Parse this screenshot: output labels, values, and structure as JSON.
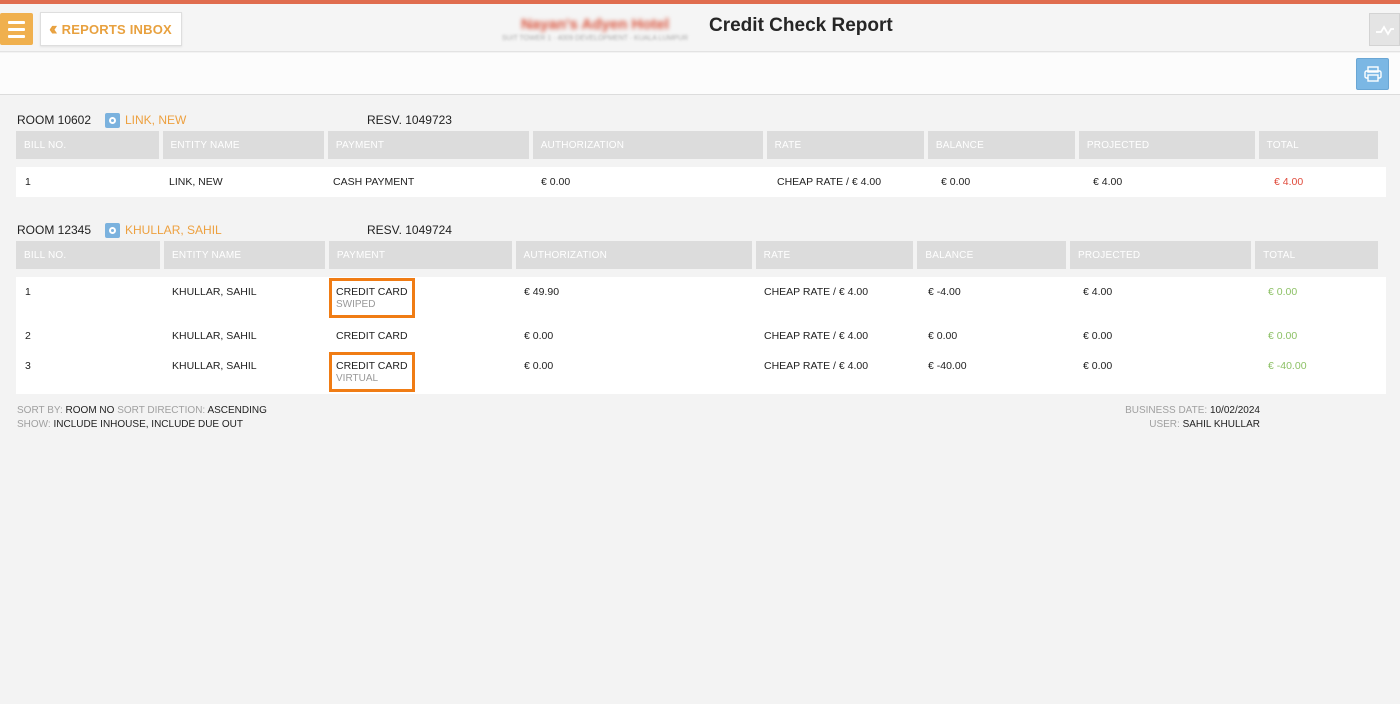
{
  "header": {
    "menu_icon": "hamburger-icon",
    "back_label": "REPORTS INBOX",
    "back_icon": "double-chevron-left-icon",
    "hotel_name": "Nayan's Adyen Hotel",
    "hotel_address": "SUIT TOWER 1 · 4009 DEVELOPMENT · KUALA LUMPUR",
    "title": "Credit Check Report",
    "graph_icon": "graph-icon"
  },
  "toolbar": {
    "print_icon": "print-icon"
  },
  "columns": [
    "BILL NO.",
    "ENTITY NAME",
    "PAYMENT",
    "AUTHORIZATION",
    "RATE",
    "BALANCE",
    "PROJECTED",
    "TOTAL"
  ],
  "rooms": [
    {
      "room": "ROOM 10602",
      "guest": "LINK, NEW",
      "resv": "RESV. 1049723",
      "rows": [
        {
          "bill": "1",
          "entity": "LINK, NEW",
          "payment": "CASH PAYMENT",
          "payment_sub": "",
          "auth": "€ 0.00",
          "rate": "CHEAP RATE / € 4.00",
          "balance": "€ 0.00",
          "projected": "€ 4.00",
          "total": "€ 4.00"
        }
      ]
    },
    {
      "room": "ROOM 12345",
      "guest": "KHULLAR, SAHIL",
      "resv": "RESV. 1049724",
      "rows": [
        {
          "bill": "1",
          "entity": "KHULLAR, SAHIL",
          "payment": "CREDIT CARD",
          "payment_sub": "SWIPED",
          "auth": "€ 49.90",
          "rate": "CHEAP RATE / € 4.00",
          "balance": "€ -4.00",
          "projected": "€ 4.00",
          "total": "€ 0.00"
        },
        {
          "bill": "2",
          "entity": "KHULLAR, SAHIL",
          "payment": "CREDIT CARD",
          "payment_sub": "",
          "auth": "€ 0.00",
          "rate": "CHEAP RATE / € 4.00",
          "balance": "€ 0.00",
          "projected": "€ 0.00",
          "total": "€ 0.00"
        },
        {
          "bill": "3",
          "entity": "KHULLAR, SAHIL",
          "payment": "CREDIT CARD",
          "payment_sub": "VIRTUAL",
          "auth": "€ 0.00",
          "rate": "CHEAP RATE / € 4.00",
          "balance": "€ -40.00",
          "projected": "€ 0.00",
          "total": "€ -40.00"
        }
      ]
    }
  ],
  "footer": {
    "sort_by_key": "SORT BY:",
    "sort_by_val": "ROOM NO",
    "sort_dir_key": "SORT DIRECTION:",
    "sort_dir_val": "ASCENDING",
    "show_key": "SHOW:",
    "show_val": "INCLUDE INHOUSE, INCLUDE DUE OUT",
    "business_date_key": "BUSINESS DATE:",
    "business_date_val": "10/02/2024",
    "user_key": "USER:",
    "user_val": "SAHIL KHULLAR"
  },
  "colors": {
    "accent": "#eda03f",
    "highlight": "#f07c14",
    "negative": "#e04b3c",
    "positive": "#8dc166"
  }
}
